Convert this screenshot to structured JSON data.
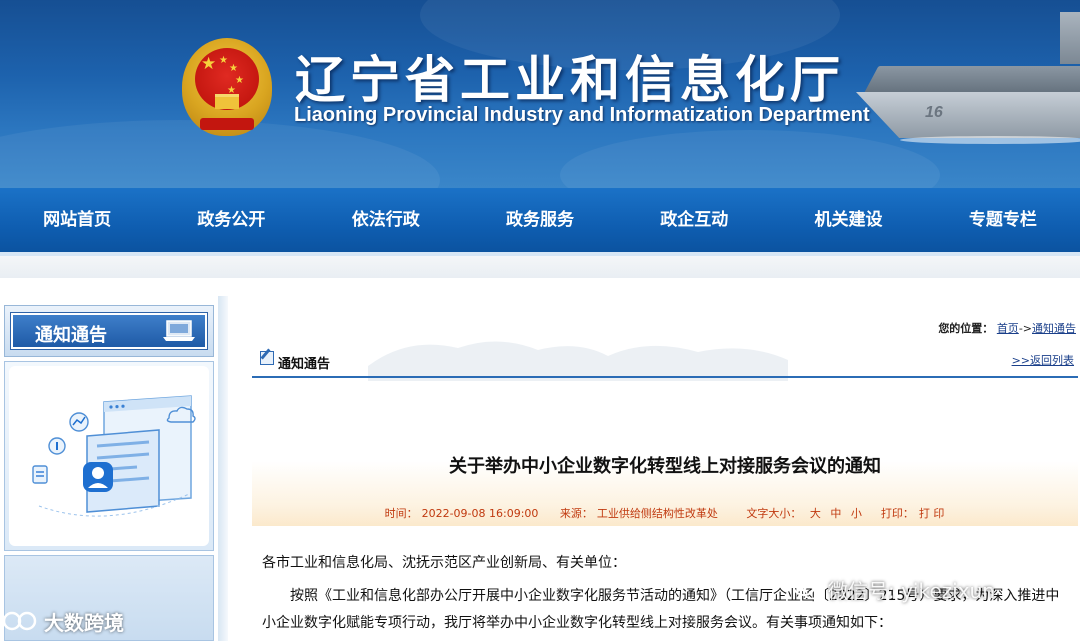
{
  "header": {
    "title_cn": "辽宁省工业和信息化厅",
    "title_en": "Liaoning Provincial Industry and Informatization Department",
    "carrier_number": "16"
  },
  "nav": {
    "items": [
      "网站首页",
      "政务公开",
      "依法行政",
      "政务服务",
      "政企互动",
      "机关建设",
      "专题专栏"
    ]
  },
  "sidebar": {
    "title": "通知通告"
  },
  "location": {
    "label": "您的位置：",
    "home": "首页",
    "sep": "->",
    "current": "通知通告"
  },
  "section": {
    "title": "通知通告",
    "back": ">>返回列表"
  },
  "article": {
    "title": "关于举办中小企业数字化转型线上对接服务会议的通知",
    "meta": {
      "time_label": "时间：",
      "time": "2022-09-08 16:09:00",
      "source_label": "来源：",
      "source": "工业供给侧结构性改革处",
      "size_label": "文字大小：",
      "size_large": "大",
      "size_medium": "中",
      "size_small": "小",
      "print_label": "打印：",
      "print": "打 印"
    },
    "salutation": "各市工业和信息化局、沈抚示范区产业创新局、有关单位：",
    "paragraph": "按照《工业和信息化部办公厅开展中小企业数字化服务节活动的通知》（工信厅企业函〔2022〕215号）要求，为深入推进中小企业数字化赋能专项行动，我厅将举办中小企业数字化转型线上对接服务会议。有关事项通知如下："
  },
  "watermarks": {
    "left": "大数跨境",
    "right": "微信号: yikezixun"
  }
}
